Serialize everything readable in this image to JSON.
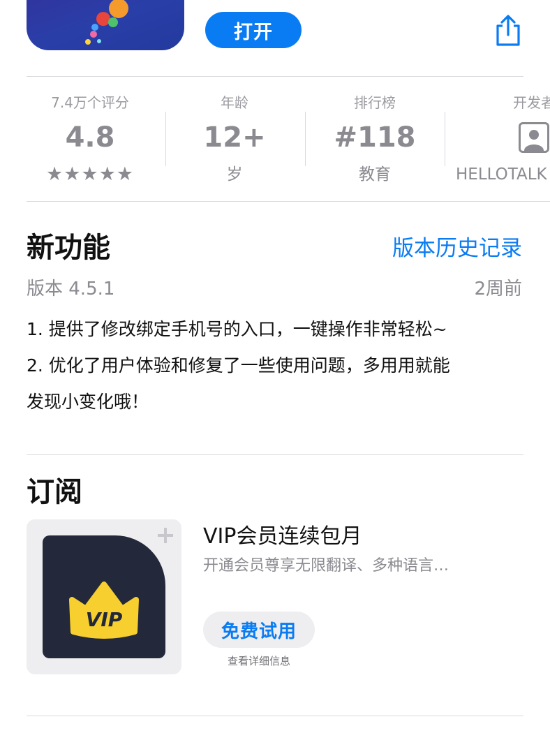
{
  "header": {
    "open_label": "打开",
    "accent_color": "#0a7cf3"
  },
  "stats": {
    "ratings": {
      "label": "7.4万个评分",
      "value": "4.8",
      "stars": "★★★★★"
    },
    "age": {
      "label": "年龄",
      "value": "12+",
      "sub": "岁"
    },
    "chart": {
      "label": "排行榜",
      "value": "#118",
      "sub": "教育"
    },
    "developer": {
      "label": "开发者",
      "sub": "HELLOTALK"
    }
  },
  "whats_new": {
    "title": "新功能",
    "history_link": "版本历史记录",
    "version": "版本 4.5.1",
    "time_ago": "2周前",
    "notes": [
      "1. 提供了修改绑定手机号的入口，一键操作非常轻松~",
      "2. 优化了用户体验和修复了一些使用问题，多用用就能",
      "发现小变化哦！"
    ]
  },
  "subscription": {
    "title": "订阅",
    "item": {
      "badge_text": "VIP",
      "name": "VIP会员连续包月",
      "description": "开通会员尊享无限翻译、多种语言…",
      "button_label": "免费试用",
      "details_link": "查看详细信息"
    }
  }
}
